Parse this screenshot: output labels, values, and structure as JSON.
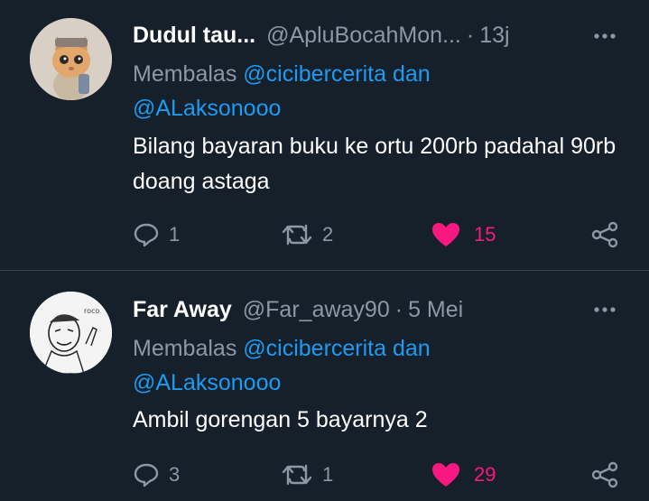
{
  "tweets": [
    {
      "avatar_icon": "cat-with-hat-avatar",
      "name": "Dudul tau...",
      "handle": "@ApluBocahMon...",
      "separator": "·",
      "time": "13j",
      "reply_prefix": "Membalas",
      "reply_mention_1": "@cicibercerita",
      "reply_joiner": "dan",
      "reply_mention_2": "@ALaksonooo",
      "text": "Bilang bayaran buku ke ortu 200rb padahal 90rb doang astaga",
      "replies": "1",
      "retweets": "2",
      "likes": "15",
      "liked": true
    },
    {
      "avatar_icon": "sketch-man-avatar",
      "name": "Far Away",
      "handle": "@Far_away90",
      "separator": "·",
      "time": "5 Mei",
      "reply_prefix": "Membalas",
      "reply_mention_1": "@cicibercerita",
      "reply_joiner": "dan",
      "reply_mention_2": "@ALaksonooo",
      "text": "Ambil gorengan 5 bayarnya 2",
      "replies": "3",
      "retweets": "1",
      "likes": "29",
      "liked": true
    }
  ],
  "colors": {
    "background": "#15202b",
    "primary_text": "#ffffff",
    "secondary_text": "#8b98a5",
    "link": "#1d9bf0",
    "like": "#f91880",
    "divider": "#38444d"
  }
}
